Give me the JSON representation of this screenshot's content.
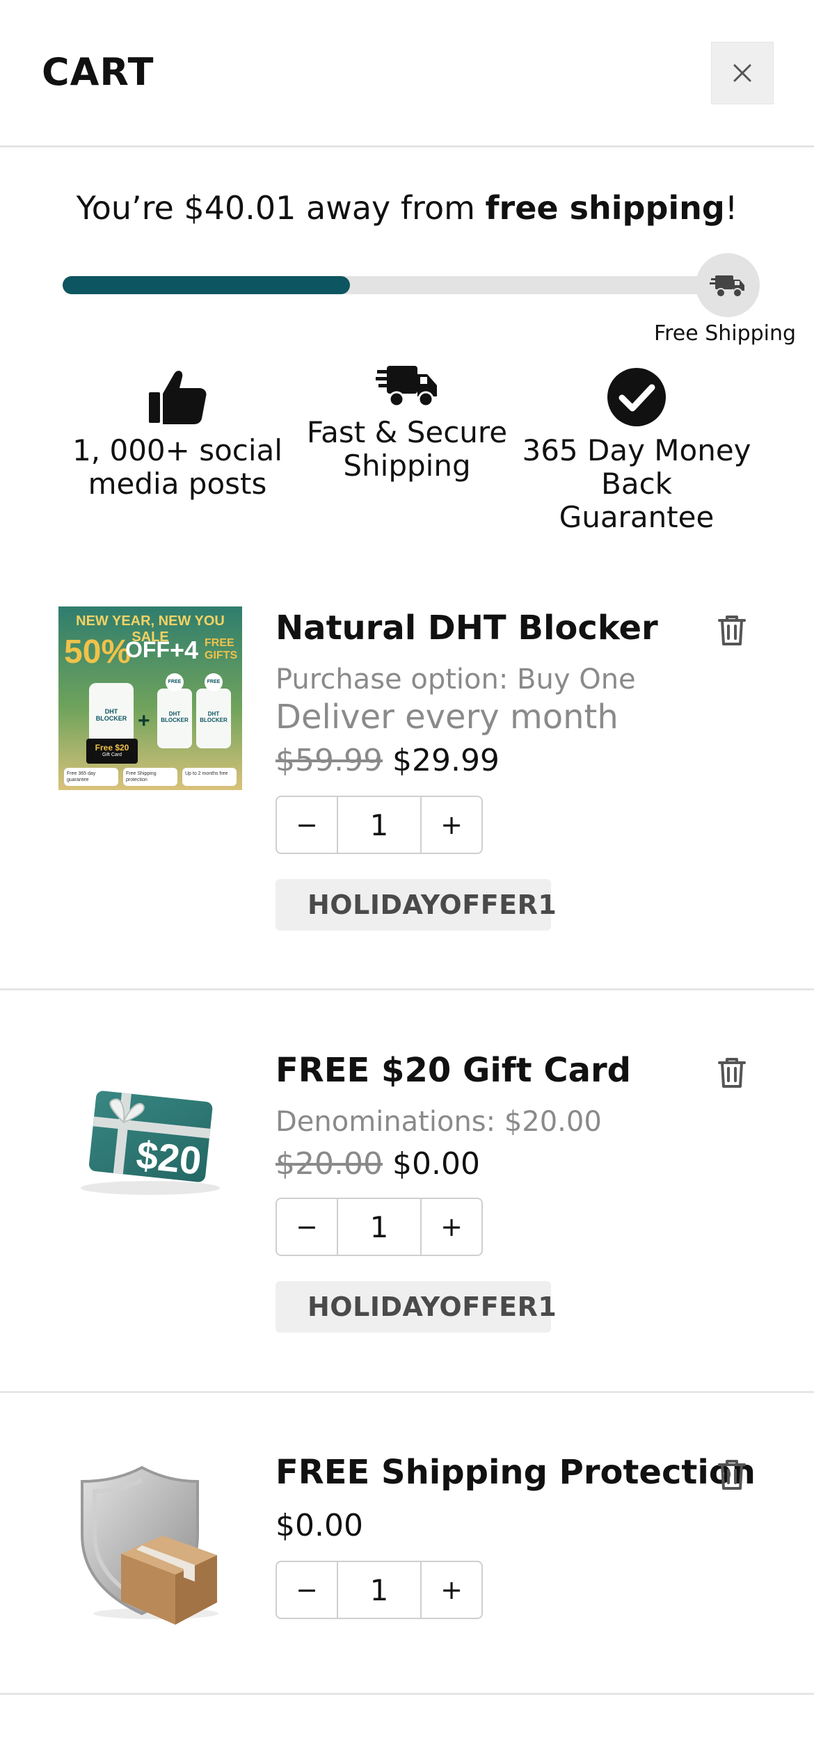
{
  "header": {
    "title": "CART",
    "close_icon": "close-icon"
  },
  "shipping": {
    "message_prefix": "You’re $40.01 away from ",
    "message_bold": "free shipping",
    "message_suffix": "!",
    "progress": 0.43,
    "label": "Free Shipping",
    "accent_color": "#0d5560",
    "icon": "truck-icon"
  },
  "features": [
    {
      "icon": "thumbs-up-icon",
      "line1": "1, 000+ social",
      "line2": "media posts",
      "line3": ""
    },
    {
      "icon": "fast-truck-icon",
      "line1": "Fast & Secure",
      "line2": "Shipping",
      "line3": ""
    },
    {
      "icon": "check-circle-icon",
      "line1": "365 Day Money",
      "line2": "Back",
      "line3": "Guarantee"
    }
  ],
  "items": [
    {
      "name": "Natural DHT Blocker",
      "option": "Purchase option: Buy One",
      "option2": "Deliver every month",
      "price_old": "$59.99",
      "price_new": "$29.99",
      "qty_minus": "−",
      "qty": "1",
      "qty_plus": "+",
      "coupon": "HOLIDAYOFFER1",
      "image": {
        "headline": "NEW YEAR, NEW YOU SALE",
        "offer_pct": "50%",
        "offer_off": "OFF",
        "offer_plus": "+4",
        "offer_free": "FREE",
        "offer_gifts": "GIFTS",
        "bottle_label": "DHT BLOCKER",
        "free_badge": "FREE",
        "gift_card": "Free $20",
        "gift_sub": "Gift Card",
        "perk1": "Free 365 day guarantee",
        "perk2": "Free Shipping protection",
        "perk3": "Up to 2 months free"
      }
    },
    {
      "name": "FREE $20 Gift Card",
      "option": "Denominations: $20.00",
      "price_old": "$20.00",
      "price_new": "$0.00",
      "qty_minus": "−",
      "qty": "1",
      "qty_plus": "+",
      "coupon": "HOLIDAYOFFER1",
      "image": {
        "card_value": "$20"
      }
    },
    {
      "name": "FREE Shipping Protection",
      "price_new": "$0.00",
      "qty_minus": "−",
      "qty": "1",
      "qty_plus": "+"
    }
  ]
}
